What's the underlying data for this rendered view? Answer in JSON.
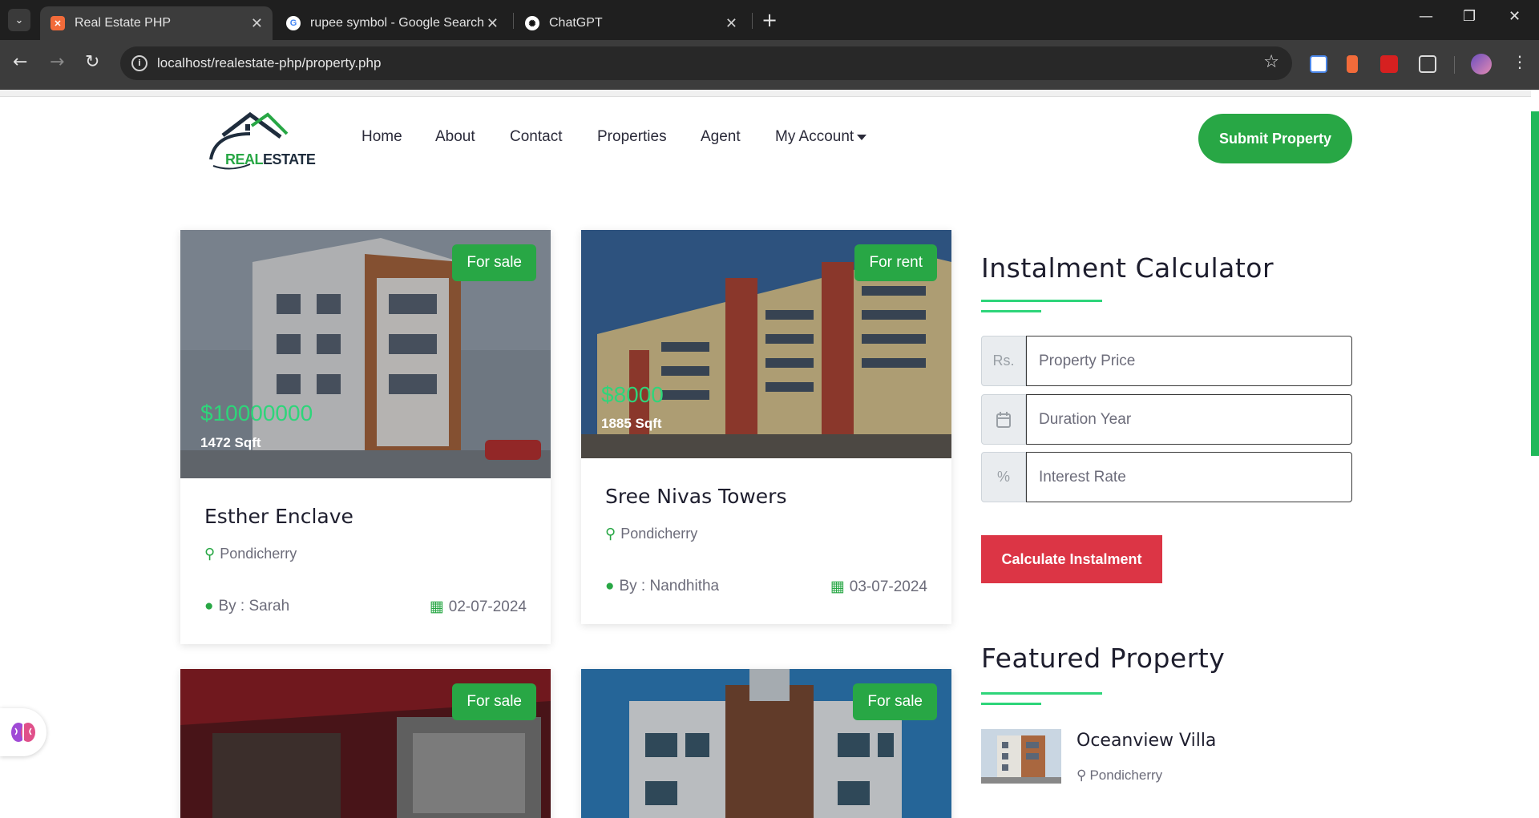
{
  "browser": {
    "tabs": [
      {
        "title": "Real Estate PHP",
        "active": true
      },
      {
        "title": "rupee symbol - Google Search",
        "active": false
      },
      {
        "title": "ChatGPT",
        "active": false
      }
    ],
    "url": "localhost/realestate-php/property.php"
  },
  "site": {
    "logo": {
      "part1": "REAL",
      "part2": "ESTATE"
    },
    "nav": [
      "Home",
      "About",
      "Contact",
      "Properties",
      "Agent",
      "My Account"
    ],
    "submit_label": "Submit Property"
  },
  "properties": [
    {
      "badge": "For sale",
      "price": "$10000000",
      "sqft": "1472 Sqft",
      "title": "Esther Enclave",
      "location": "Pondicherry",
      "by": "By : Sarah",
      "date": "02-07-2024"
    },
    {
      "badge": "For rent",
      "price": "$8000",
      "sqft": "1885 Sqft",
      "title": "Sree Nivas Towers",
      "location": "Pondicherry",
      "by": "By : Nandhitha",
      "date": "03-07-2024"
    },
    {
      "badge": "For sale"
    },
    {
      "badge": "For sale"
    }
  ],
  "calculator": {
    "heading": "Instalment Calculator",
    "fields": [
      {
        "addon": "Rs.",
        "placeholder": "Property Price"
      },
      {
        "addon_icon": "calendar-icon",
        "placeholder": "Duration Year"
      },
      {
        "addon": "%",
        "placeholder": "Interest Rate"
      }
    ],
    "button": "Calculate Instalment"
  },
  "featured": {
    "heading": "Featured Property",
    "items": [
      {
        "title": "Oceanview Villa",
        "location": "Pondicherry"
      }
    ]
  },
  "colors": {
    "brand_green": "#28a745",
    "price_green": "#2ed57a",
    "calc_red": "#dc3545"
  }
}
